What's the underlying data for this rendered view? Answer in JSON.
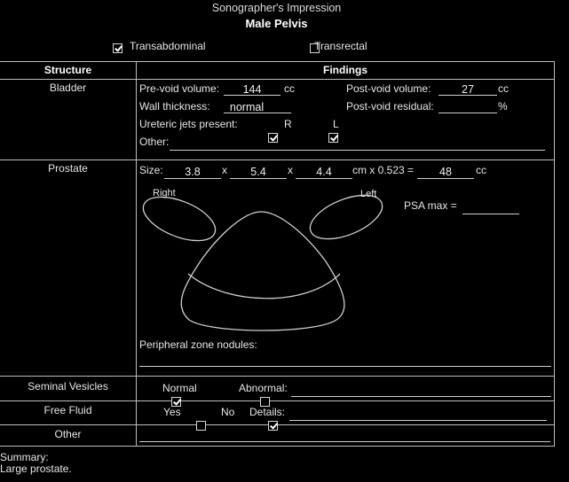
{
  "header": {
    "title": "Sonographer's Impression",
    "subtitle": "Male Pelvis"
  },
  "approach": {
    "transabdominal": {
      "label": "Transabdominal",
      "checked": true
    },
    "transrectal": {
      "label": "Transrectal",
      "checked": false
    }
  },
  "table": {
    "col1": "Structure",
    "col2": "Findings"
  },
  "bladder": {
    "name": "Bladder",
    "pre_void_label": "Pre-void volume:",
    "pre_void_value": "144",
    "pre_void_unit": "cc",
    "post_void_label": "Post-void volume:",
    "post_void_value": "27",
    "post_void_unit": "cc",
    "wall_label": "Wall thickness:",
    "wall_value": "normal",
    "residual_label": "Post-void residual:",
    "residual_value": "",
    "residual_unit": "%",
    "jets_label": "Ureteric jets present:",
    "jet_r": "R",
    "jet_l": "L",
    "jet_r_checked": true,
    "jet_l_checked": true,
    "other_label": "Other:",
    "other_value": ""
  },
  "prostate": {
    "name": "Prostate",
    "size_label": "Size:",
    "d1": "3.8",
    "x1": "x",
    "d2": "5.4",
    "x2": "x",
    "d3": "4.4",
    "formula": "cm x 0.523 =",
    "volume": "48",
    "volume_unit": "cc",
    "right_label": "Right",
    "left_label": "Left",
    "psa_label": "PSA max =",
    "psa_value": "",
    "nodules_label": "Peripheral zone nodules:",
    "nodules_value": ""
  },
  "seminal": {
    "name": "Seminal Vesicles",
    "normal_label": "Normal",
    "normal_checked": true,
    "abnormal_label": "Abnormal:",
    "abnormal_checked": false,
    "abnormal_value": ""
  },
  "fluid": {
    "name": "Free Fluid",
    "yes_label": "Yes",
    "yes_checked": false,
    "no_label": "No",
    "no_checked": true,
    "details_label": "Details:",
    "details_value": ""
  },
  "other": {
    "name": "Other",
    "value": ""
  },
  "summary": {
    "label": "Summary:",
    "text": "Large prostate."
  }
}
